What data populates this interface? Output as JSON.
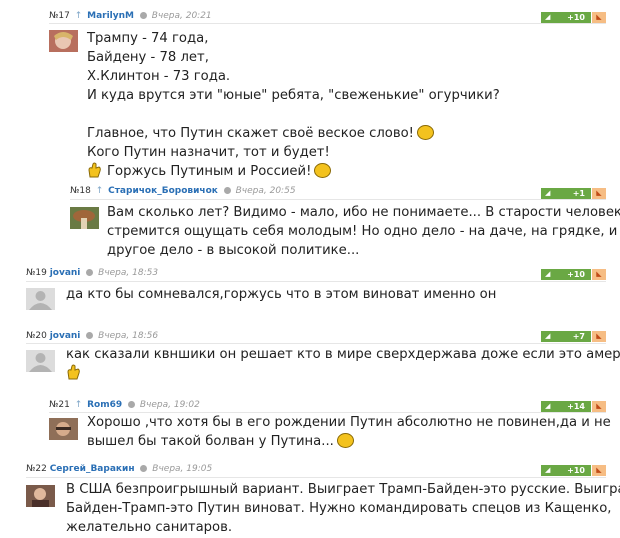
{
  "comments": [
    {
      "number": "№17",
      "user": "MarilynM",
      "time": "Вчера, 20:21",
      "score": "+10",
      "lines": [
        "Трампу - 74 года,",
        "Байдену - 78 лет,",
        "Х.Клинтон - 73 года.",
        "И куда врутся эти \"юные\" ребята, \"свеженькие\" огурчики?",
        "",
        "Главное, что Путин скажет своё веское слово!",
        "Кого Путин назначит, тот и будет!",
        "Горжусь Путиным и Россией!"
      ]
    },
    {
      "number": "№18",
      "user": "Старичок_Боровичок",
      "time": "Вчера, 20:55",
      "score": "+1",
      "lines": [
        "Вам сколько лет? Видимо - мало, ибо не понимаете... В старости человек",
        "стремится ощущать себя молодым! Но одно дело - на даче, на грядке, и",
        "другое дело - в высокой политике..."
      ]
    },
    {
      "number": "№19",
      "user": "jovani",
      "time": "Вчера, 18:53",
      "score": "+10",
      "lines": [
        "да кто бы сомневался,горжусь что в этом виноват именно он"
      ]
    },
    {
      "number": "№20",
      "user": "jovani",
      "time": "Вчера, 18:56",
      "score": "+7",
      "lines": [
        "как сказали квншики он решает кто в мире сверхдержава доже если это америка"
      ]
    },
    {
      "number": "№21",
      "user": "Rom69",
      "time": "Вчера, 19:02",
      "score": "+14",
      "lines": [
        "Хорошо ,что хотя бы в его рождении Путин абсолютно не повинен,да и не",
        "вышел бы такой болван у Путина..."
      ]
    },
    {
      "number": "№22",
      "user": "Сергей_Варакин",
      "time": "Вчера, 19:05",
      "score": "+10",
      "lines": [
        "В США безпроигрышный вариант. Выиграет Трамп-Байден-это русские. Выиграет",
        "Байден-Трамп-это Путин виноват. Нужно командировать спецов из Кащенко,",
        "желательно санитаров."
      ]
    }
  ],
  "icons": {
    "reply_arrow": "reply-arrow-icon",
    "online_status": "status-dot-icon",
    "vote_up": "thumb-up-icon",
    "vote_down": "thumb-down-icon",
    "smiley": "smiley-icon",
    "hand": "hand-icon"
  },
  "colors": {
    "username": "#2a6fb5",
    "vote_up_bg": "#6aa844",
    "vote_down_bg": "#f6bd84",
    "status_dot": "#a9a9a9",
    "timestamp": "#9a9a9a"
  }
}
